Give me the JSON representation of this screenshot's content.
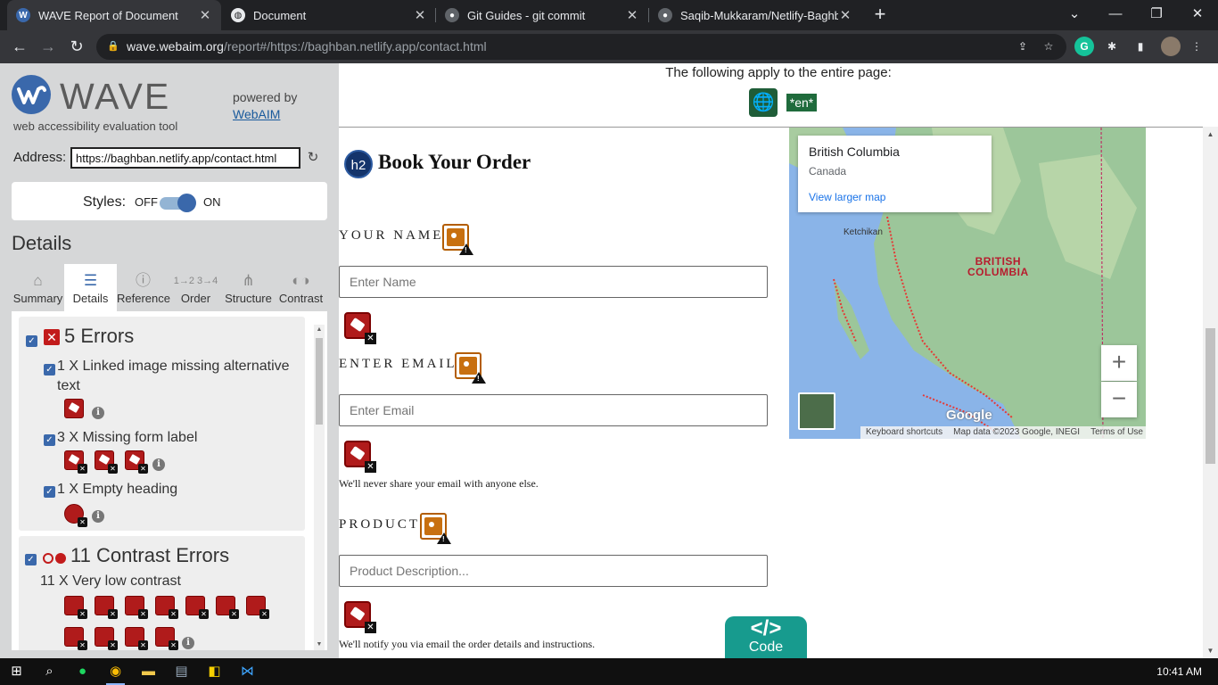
{
  "browser": {
    "tabs": [
      {
        "title": "WAVE Report of Document",
        "icon": "wave-favicon",
        "active": true
      },
      {
        "title": "Document",
        "icon": "globe-favicon",
        "active": false
      },
      {
        "title": "Git Guides - git commit",
        "icon": "github-favicon",
        "active": false
      },
      {
        "title": "Saqib-Mukkaram/Netlify-Baghban",
        "icon": "github-favicon",
        "active": false
      }
    ],
    "new_tab": "+",
    "window_controls": {
      "minimize": "—",
      "restore": "❐",
      "close": "✕"
    },
    "chevron": "⌄",
    "url_host": "wave.webaim.org",
    "url_rest": "/report#/https://baghban.netlify.app/contact.html"
  },
  "wave": {
    "logo_word": "WAVE",
    "tagline": "web accessibility evaluation tool",
    "powered_by": "powered by",
    "webaim_link": "WebAIM",
    "address_label": "Address:",
    "address_value": "https://baghban.netlify.app/contact.html",
    "styles_label": "Styles:",
    "styles_off": "OFF",
    "styles_on": "ON",
    "details_heading": "Details",
    "tabs": [
      {
        "label": "Summary",
        "icon": "home-icon"
      },
      {
        "label": "Details",
        "icon": "list-icon",
        "active": true
      },
      {
        "label": "Reference",
        "icon": "info-icon"
      },
      {
        "label": "Order",
        "icon": "order-icon"
      },
      {
        "label": "Structure",
        "icon": "structure-icon"
      },
      {
        "label": "Contrast",
        "icon": "contrast-icon"
      }
    ],
    "errors": {
      "heading": "5 Errors",
      "items": [
        {
          "text": "1 X Linked image missing alternative text",
          "count": 1
        },
        {
          "text": "3 X Missing form label",
          "count": 3
        },
        {
          "text": "1 X Empty heading",
          "count": 1
        }
      ]
    },
    "contrast": {
      "heading": "11 Contrast Errors",
      "items": [
        {
          "text": "11 X Very low contrast",
          "count": 11
        }
      ]
    }
  },
  "page": {
    "apply_text": "The following apply to the entire page:",
    "lang_badge": "*en*",
    "h2_badge": "h2",
    "heading": "Book Your Order",
    "fields": [
      {
        "label": "YOUR NAME",
        "placeholder": "Enter Name",
        "help": ""
      },
      {
        "label": "ENTER EMAIL",
        "placeholder": "Enter Email",
        "help": "We'll never share your email with anyone else."
      },
      {
        "label": "PRODUCT",
        "placeholder": "Product Description...",
        "help": "We'll notify you via email the order details and instructions."
      }
    ],
    "map": {
      "place": "British Columbia",
      "country": "Canada",
      "view_larger": "View larger map",
      "region_label_line1": "BRITISH",
      "region_label_line2": "COLUMBIA",
      "city": "Ketchikan",
      "zoom_in": "+",
      "zoom_out": "−",
      "brand": "Google",
      "footer_shortcuts": "Keyboard shortcuts",
      "footer_data": "Map data ©2023 Google, INEGI",
      "footer_terms": "Terms of Use"
    },
    "code_button": {
      "symbol": "</>",
      "label": "Code"
    }
  },
  "taskbar": {
    "clock": "10:41 AM",
    "apps": [
      "windows-start-icon",
      "search-icon",
      "spotify-icon",
      "chrome-icon",
      "file-explorer-icon",
      "notepad-icon",
      "sticky-notes-icon",
      "vscode-icon"
    ]
  }
}
